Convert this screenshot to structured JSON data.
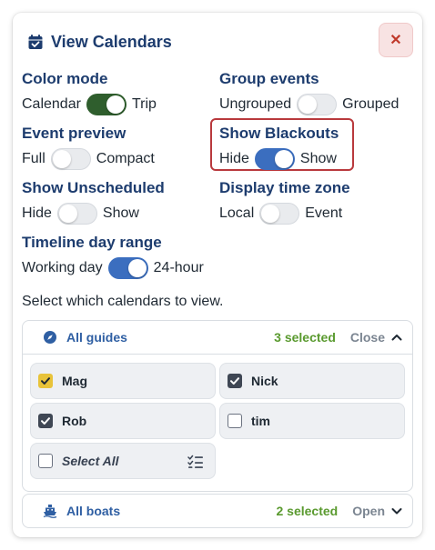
{
  "header": {
    "title": "View Calendars",
    "close_glyph": "✕",
    "calendar_icon": "calendar-check-icon"
  },
  "options": [
    {
      "key": "color_mode",
      "label": "Color mode",
      "left": "Calendar",
      "right": "Trip",
      "on": true,
      "color": "#2f5e2d"
    },
    {
      "key": "group_events",
      "label": "Group events",
      "left": "Ungrouped",
      "right": "Grouped",
      "on": false
    },
    {
      "key": "event_preview",
      "label": "Event preview",
      "left": "Full",
      "right": "Compact",
      "on": false
    },
    {
      "key": "show_blackouts",
      "label": "Show Blackouts",
      "left": "Hide",
      "right": "Show",
      "on": true,
      "color": "#3b6ebf"
    },
    {
      "key": "show_unscheduled",
      "label": "Show Unscheduled",
      "left": "Hide",
      "right": "Show",
      "on": false
    },
    {
      "key": "display_time_zone",
      "label": "Display time zone",
      "left": "Local",
      "right": "Event",
      "on": false
    },
    {
      "key": "timeline_day_range",
      "label": "Timeline day range",
      "left": "Working day",
      "right": "24-hour",
      "on": true,
      "color": "#3b6ebf"
    }
  ],
  "hint": "Select which calendars to view.",
  "guides": {
    "name": "All guides",
    "count": "3 selected",
    "action": "Close",
    "items": [
      {
        "label": "Mag",
        "checked": true,
        "check_color": "#e8c33a",
        "check_mark": "#1f2933"
      },
      {
        "label": "Nick",
        "checked": true,
        "check_color": "#3f4754",
        "check_mark": "#ffffff"
      },
      {
        "label": "Rob",
        "checked": true,
        "check_color": "#3f4754",
        "check_mark": "#ffffff"
      },
      {
        "label": "tim",
        "checked": false
      }
    ],
    "select_all": "Select All"
  },
  "boats": {
    "name": "All boats",
    "count": "2 selected",
    "action": "Open"
  },
  "colors": {
    "accent": "#1d3c6e",
    "highlight": "#b9393d",
    "selected_count": "#5a9a2f"
  }
}
